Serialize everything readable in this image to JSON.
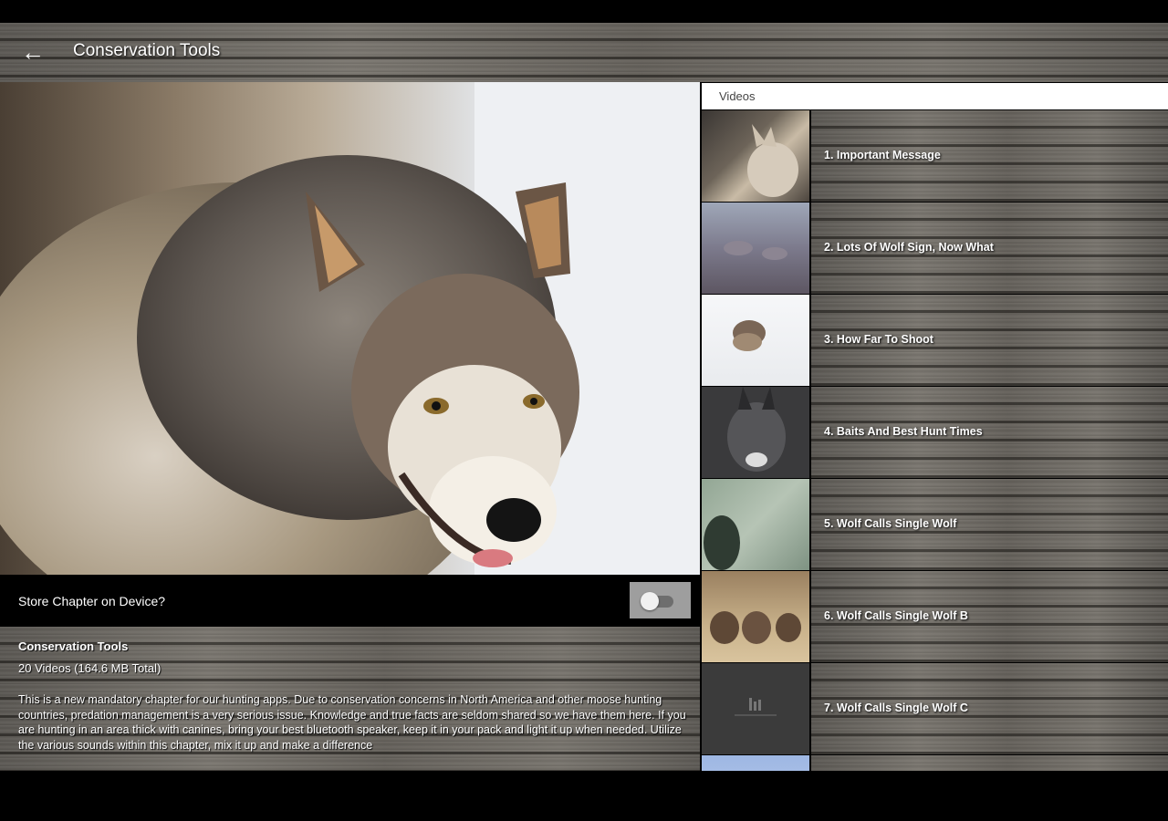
{
  "appbar": {
    "back_icon": "arrow-left-icon",
    "title": "Conservation Tools"
  },
  "hero": {
    "image": "gray-wolf-in-snow-photo"
  },
  "store": {
    "label": "Store Chapter on Device?",
    "toggle_on": false
  },
  "description": {
    "title": "Conservation Tools",
    "count": "20 Videos (164.6 MB Total)",
    "body": "This is a new mandatory chapter for our hunting apps. Due to conservation concerns in North America and other moose hunting countries, predation management is a very serious issue. Knowledge and true facts are seldom shared so we have them here. If you are hunting in an area thick with canines, bring your best bluetooth speaker, keep it in your pack and light it up when needed. Utilize the various sounds within this chapter, mix it up and make a difference"
  },
  "videos": {
    "header": "Videos",
    "items": [
      {
        "label": "1. Important Message",
        "thumb": "howling-wolf-thumbnail"
      },
      {
        "label": "2. Lots Of Wolf Sign, Now What",
        "thumb": "wolf-pack-in-brush-thumbnail"
      },
      {
        "label": "3. How Far To Shoot",
        "thumb": "wolves-in-snow-thumbnail"
      },
      {
        "label": "4. Baits And Best Hunt Times",
        "thumb": "black-wolf-face-thumbnail"
      },
      {
        "label": "5. Wolf Calls Single Wolf",
        "thumb": "wolf-painting-thumbnail"
      },
      {
        "label": "6. Wolf Calls Single Wolf B",
        "thumb": "wolf-pups-thumbnail"
      },
      {
        "label": "7. Wolf Calls Single Wolf C",
        "thumb": "placeholder-thumbnail"
      },
      {
        "label": "",
        "thumb": "blue-sky-thumbnail"
      }
    ]
  }
}
